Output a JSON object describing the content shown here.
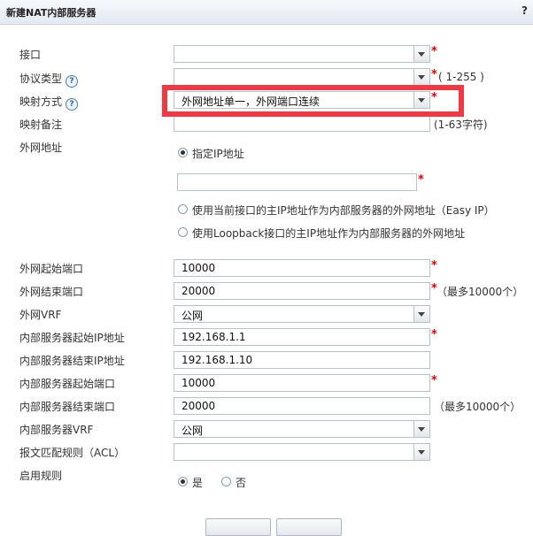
{
  "dialog": {
    "title": "新建NAT内部服务器",
    "help": "?"
  },
  "form": {
    "interface": {
      "label": "接口",
      "value": ""
    },
    "protocol": {
      "label": "协议类型",
      "value": "",
      "note": "( 1-255 )"
    },
    "mapping": {
      "label": "映射方式",
      "value": "外网地址单一，外网端口连续"
    },
    "remark": {
      "label": "映射备注",
      "value": "",
      "note": "(1-63字符)"
    },
    "wan_address": {
      "label": "外网地址",
      "options": [
        "指定IP地址",
        "使用当前接口的主IP地址作为内部服务器的外网地址（Easy IP）",
        "使用Loopback接口的主IP地址作为内部服务器的外网地址"
      ],
      "selected": 0,
      "ip_value": ""
    },
    "wan_start_port": {
      "label": "外网起始端口",
      "value": "10000"
    },
    "wan_end_port": {
      "label": "外网结束端口",
      "value": "20000",
      "note": "（最多10000个）"
    },
    "wan_vrf": {
      "label": "外网VRF",
      "value": "公网"
    },
    "server_start_ip": {
      "label": "内部服务器起始IP地址",
      "value": "192.168.1.1"
    },
    "server_end_ip": {
      "label": "内部服务器结束IP地址",
      "value": "192.168.1.10"
    },
    "server_start_port": {
      "label": "内部服务器起始端口",
      "value": "10000"
    },
    "server_end_port": {
      "label": "内部服务器结束端口",
      "value": "20000",
      "note": "（最多10000个）"
    },
    "server_vrf": {
      "label": "内部服务器VRF",
      "value": "公网"
    },
    "acl": {
      "label": "报文匹配规则（ACL）",
      "value": ""
    },
    "enable": {
      "label": "启用规则",
      "yes": "是",
      "no": "否",
      "selected": "yes"
    },
    "required_mark": "*"
  },
  "colors": {
    "highlight": "#ef3a44",
    "required": "#e00000",
    "header_bg": "#e8eef5"
  }
}
